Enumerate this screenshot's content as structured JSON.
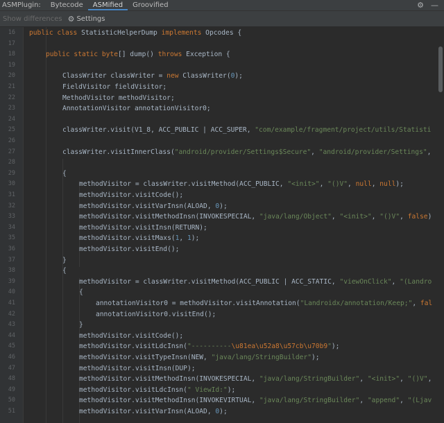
{
  "tabs": [
    {
      "label": "ASMPlugin:",
      "active": false
    },
    {
      "label": "Bytecode",
      "active": false
    },
    {
      "label": "ASMified",
      "active": true
    },
    {
      "label": "Groovified",
      "active": false
    }
  ],
  "toolbar": {
    "show_differences": "Show differences",
    "settings": "Settings"
  },
  "icons": {
    "gear": "gear-icon",
    "minimize": "minimize-icon"
  },
  "colors": {
    "background": "#2b2b2b",
    "keyword": "#cc7832",
    "string": "#6a8759",
    "number": "#6897bb",
    "text": "#a9b7c6"
  },
  "editor": {
    "lines": [
      {
        "num": "16",
        "indent": 0,
        "tokens": [
          [
            "k",
            "public class "
          ],
          [
            "t",
            "StatisticHelperDump "
          ],
          [
            "k",
            "implements "
          ],
          [
            "t",
            "Opcodes {"
          ]
        ]
      },
      {
        "num": "17",
        "indent": 0,
        "tokens": []
      },
      {
        "num": "18",
        "indent": 1,
        "tokens": [
          [
            "k",
            "public static byte"
          ],
          [
            "t",
            "[] dump() "
          ],
          [
            "k",
            "throws "
          ],
          [
            "t",
            "Exception {"
          ]
        ]
      },
      {
        "num": "19",
        "indent": 0,
        "tokens": []
      },
      {
        "num": "20",
        "indent": 2,
        "tokens": [
          [
            "t",
            "ClassWriter classWriter = "
          ],
          [
            "k",
            "new "
          ],
          [
            "t",
            "ClassWriter("
          ],
          [
            "n",
            "0"
          ],
          [
            "t",
            ");"
          ]
        ]
      },
      {
        "num": "21",
        "indent": 2,
        "tokens": [
          [
            "t",
            "FieldVisitor fieldVisitor;"
          ]
        ]
      },
      {
        "num": "22",
        "indent": 2,
        "tokens": [
          [
            "t",
            "MethodVisitor methodVisitor;"
          ]
        ]
      },
      {
        "num": "23",
        "indent": 2,
        "tokens": [
          [
            "t",
            "AnnotationVisitor annotationVisitor0;"
          ]
        ]
      },
      {
        "num": "24",
        "indent": 0,
        "tokens": []
      },
      {
        "num": "25",
        "indent": 2,
        "tokens": [
          [
            "t",
            "classWriter.visit(V1_8, ACC_PUBLIC | ACC_SUPER, "
          ],
          [
            "s",
            "\"com/example/fragment/project/utils/Statisti"
          ]
        ]
      },
      {
        "num": "26",
        "indent": 0,
        "tokens": []
      },
      {
        "num": "27",
        "indent": 2,
        "tokens": [
          [
            "t",
            "classWriter.visitInnerClass("
          ],
          [
            "s",
            "\"android/provider/Settings$Secure\""
          ],
          [
            "t",
            ", "
          ],
          [
            "s",
            "\"android/provider/Settings\""
          ],
          [
            "t",
            ","
          ]
        ]
      },
      {
        "num": "28",
        "indent": 0,
        "tokens": []
      },
      {
        "num": "29",
        "indent": 2,
        "tokens": [
          [
            "t",
            "{"
          ]
        ]
      },
      {
        "num": "30",
        "indent": 3,
        "tokens": [
          [
            "t",
            "methodVisitor = classWriter.visitMethod(ACC_PUBLIC, "
          ],
          [
            "s",
            "\"<init>\""
          ],
          [
            "t",
            ", "
          ],
          [
            "s",
            "\"()V\""
          ],
          [
            "t",
            ", "
          ],
          [
            "k",
            "null"
          ],
          [
            "t",
            ", "
          ],
          [
            "k",
            "null"
          ],
          [
            "t",
            ");"
          ]
        ]
      },
      {
        "num": "31",
        "indent": 3,
        "tokens": [
          [
            "t",
            "methodVisitor.visitCode();"
          ]
        ]
      },
      {
        "num": "32",
        "indent": 3,
        "tokens": [
          [
            "t",
            "methodVisitor.visitVarInsn(ALOAD, "
          ],
          [
            "n",
            "0"
          ],
          [
            "t",
            ");"
          ]
        ]
      },
      {
        "num": "33",
        "indent": 3,
        "tokens": [
          [
            "t",
            "methodVisitor.visitMethodInsn(INVOKESPECIAL, "
          ],
          [
            "s",
            "\"java/lang/Object\""
          ],
          [
            "t",
            ", "
          ],
          [
            "s",
            "\"<init>\""
          ],
          [
            "t",
            ", "
          ],
          [
            "s",
            "\"()V\""
          ],
          [
            "t",
            ", "
          ],
          [
            "k",
            "false"
          ],
          [
            "t",
            ")"
          ]
        ]
      },
      {
        "num": "34",
        "indent": 3,
        "tokens": [
          [
            "t",
            "methodVisitor.visitInsn(RETURN);"
          ]
        ]
      },
      {
        "num": "35",
        "indent": 3,
        "tokens": [
          [
            "t",
            "methodVisitor.visitMaxs("
          ],
          [
            "n",
            "1"
          ],
          [
            "t",
            ", "
          ],
          [
            "n",
            "1"
          ],
          [
            "t",
            ");"
          ]
        ]
      },
      {
        "num": "36",
        "indent": 3,
        "tokens": [
          [
            "t",
            "methodVisitor.visitEnd();"
          ]
        ]
      },
      {
        "num": "37",
        "indent": 2,
        "tokens": [
          [
            "t",
            "}"
          ]
        ]
      },
      {
        "num": "38",
        "indent": 2,
        "tokens": [
          [
            "t",
            "{"
          ]
        ]
      },
      {
        "num": "39",
        "indent": 3,
        "tokens": [
          [
            "t",
            "methodVisitor = classWriter.visitMethod(ACC_PUBLIC | ACC_STATIC, "
          ],
          [
            "s",
            "\"viewOnClick\""
          ],
          [
            "t",
            ", "
          ],
          [
            "s",
            "\"(Landro"
          ]
        ]
      },
      {
        "num": "40",
        "indent": 3,
        "tokens": [
          [
            "t",
            "{"
          ]
        ]
      },
      {
        "num": "41",
        "indent": 4,
        "tokens": [
          [
            "t",
            "annotationVisitor0 = methodVisitor.visitAnnotation("
          ],
          [
            "s",
            "\"Landroidx/annotation/Keep;\""
          ],
          [
            "t",
            ", "
          ],
          [
            "k",
            "fal"
          ]
        ]
      },
      {
        "num": "42",
        "indent": 4,
        "tokens": [
          [
            "t",
            "annotationVisitor0.visitEnd();"
          ]
        ]
      },
      {
        "num": "43",
        "indent": 3,
        "tokens": [
          [
            "t",
            "}"
          ]
        ]
      },
      {
        "num": "44",
        "indent": 3,
        "tokens": [
          [
            "t",
            "methodVisitor.visitCode();"
          ]
        ]
      },
      {
        "num": "45",
        "indent": 3,
        "tokens": [
          [
            "t",
            "methodVisitor.visitLdcInsn("
          ],
          [
            "s",
            "\"----------"
          ],
          [
            "e",
            "\\u81ea\\u52a8\\u57cb\\u70b9"
          ],
          [
            "s",
            "\""
          ],
          [
            "t",
            ");"
          ]
        ]
      },
      {
        "num": "46",
        "indent": 3,
        "tokens": [
          [
            "t",
            "methodVisitor.visitTypeInsn(NEW, "
          ],
          [
            "s",
            "\"java/lang/StringBuilder\""
          ],
          [
            "t",
            ");"
          ]
        ]
      },
      {
        "num": "47",
        "indent": 3,
        "tokens": [
          [
            "t",
            "methodVisitor.visitInsn(DUP);"
          ]
        ]
      },
      {
        "num": "48",
        "indent": 3,
        "tokens": [
          [
            "t",
            "methodVisitor.visitMethodInsn(INVOKESPECIAL, "
          ],
          [
            "s",
            "\"java/lang/StringBuilder\""
          ],
          [
            "t",
            ", "
          ],
          [
            "s",
            "\"<init>\""
          ],
          [
            "t",
            ", "
          ],
          [
            "s",
            "\"()V\""
          ],
          [
            "t",
            ","
          ]
        ]
      },
      {
        "num": "49",
        "indent": 3,
        "tokens": [
          [
            "t",
            "methodVisitor.visitLdcInsn("
          ],
          [
            "s",
            "\" ViewId:\""
          ],
          [
            "t",
            ");"
          ]
        ]
      },
      {
        "num": "50",
        "indent": 3,
        "tokens": [
          [
            "t",
            "methodVisitor.visitMethodInsn(INVOKEVIRTUAL, "
          ],
          [
            "s",
            "\"java/lang/StringBuilder\""
          ],
          [
            "t",
            ", "
          ],
          [
            "s",
            "\"append\""
          ],
          [
            "t",
            ", "
          ],
          [
            "s",
            "\"(Ljav"
          ]
        ]
      },
      {
        "num": "51",
        "indent": 3,
        "tokens": [
          [
            "t",
            "methodVisitor.visitVarInsn(ALOAD, "
          ],
          [
            "n",
            "0"
          ],
          [
            "t",
            ");"
          ]
        ]
      }
    ]
  }
}
